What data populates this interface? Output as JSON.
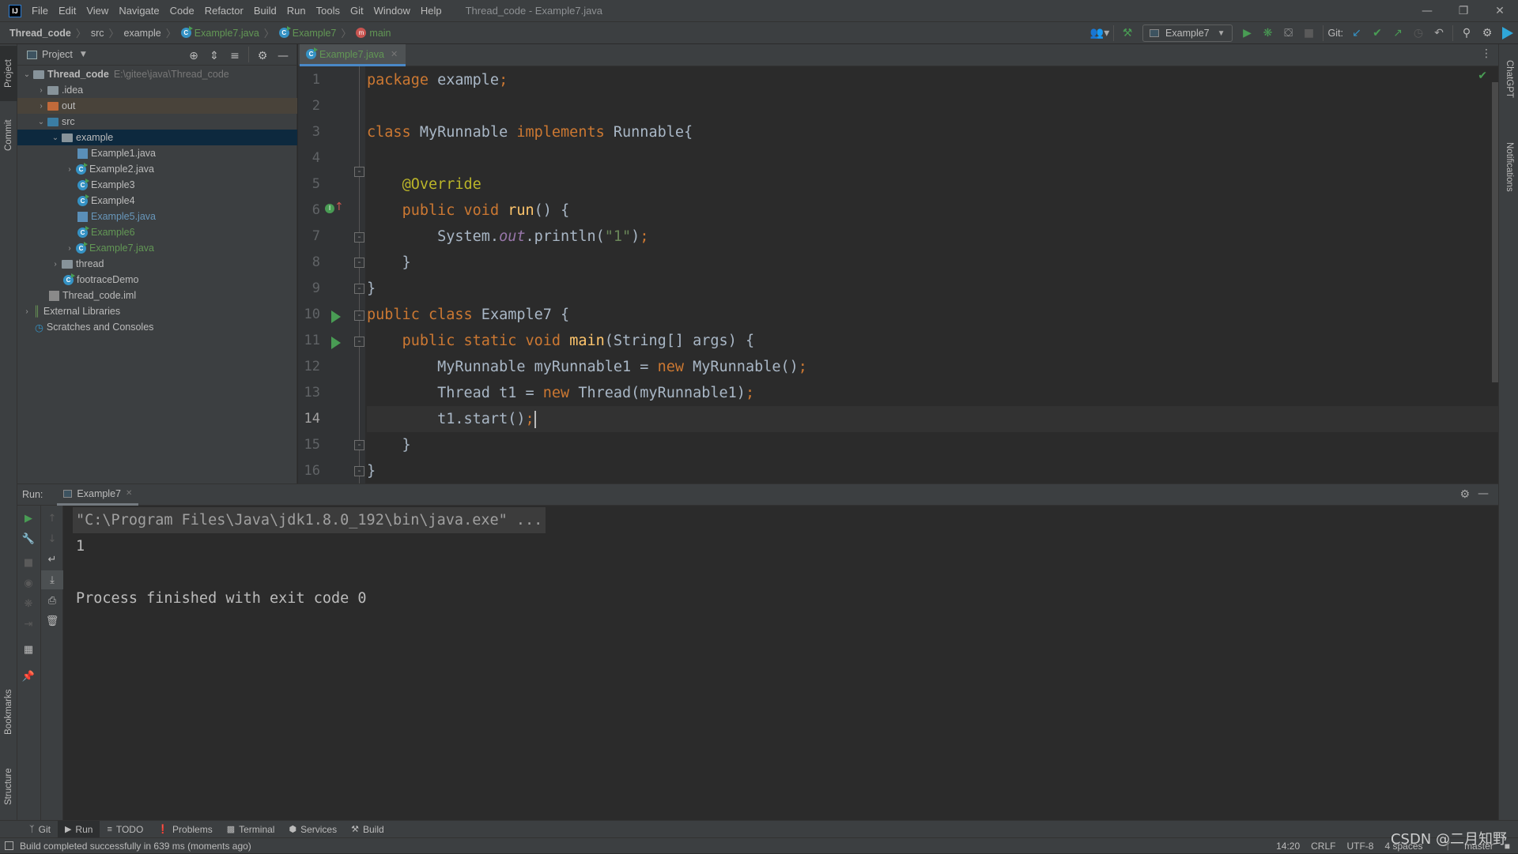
{
  "app": {
    "logo": "IJ",
    "menu": [
      "File",
      "Edit",
      "View",
      "Navigate",
      "Code",
      "Refactor",
      "Build",
      "Run",
      "Tools",
      "Git",
      "Window",
      "Help"
    ],
    "window_title": "Thread_code - Example7.java"
  },
  "breadcrumb": {
    "project": "Thread_code",
    "items": [
      "src",
      "example",
      "Example7.java",
      "Example7",
      "main"
    ]
  },
  "toolbar": {
    "run_config": "Example7",
    "git_label": "Git:"
  },
  "left_stripe": {
    "project": "Project",
    "commit": "Commit",
    "bookmarks": "Bookmarks",
    "structure": "Structure"
  },
  "right_stripe": {
    "chatgpt": "ChatGPT",
    "notifications": "Notifications"
  },
  "project_panel": {
    "title": "Project",
    "root": {
      "name": "Thread_code",
      "path": "E:\\gitee\\java\\Thread_code"
    },
    "tree": [
      {
        "name": ".idea",
        "type": "folder",
        "depth": 1,
        "expanded": false
      },
      {
        "name": "out",
        "type": "folder-excluded",
        "depth": 1,
        "expanded": false
      },
      {
        "name": "src",
        "type": "folder-source",
        "depth": 1,
        "expanded": true
      },
      {
        "name": "example",
        "type": "package",
        "depth": 2,
        "expanded": true,
        "selected": true
      },
      {
        "name": "Example1.java",
        "type": "java-file",
        "depth": 3
      },
      {
        "name": "Example2.java",
        "type": "class",
        "depth": 3,
        "expandable": true
      },
      {
        "name": "Example3",
        "type": "class",
        "depth": 3
      },
      {
        "name": "Example4",
        "type": "class",
        "depth": 3
      },
      {
        "name": "Example5.java",
        "type": "java-file",
        "depth": 3,
        "status": "modified"
      },
      {
        "name": "Example6",
        "type": "class",
        "depth": 3,
        "status": "added"
      },
      {
        "name": "Example7.java",
        "type": "class",
        "depth": 3,
        "status": "added",
        "expandable": true
      },
      {
        "name": "thread",
        "type": "package",
        "depth": 2,
        "expanded": false
      },
      {
        "name": "footraceDemo",
        "type": "class",
        "depth": 2
      },
      {
        "name": "Thread_code.iml",
        "type": "iml",
        "depth": 1
      }
    ],
    "external_libraries": "External Libraries",
    "scratches": "Scratches and Consoles"
  },
  "editor": {
    "tab": "Example7.java",
    "current_line": 14,
    "lines": [
      "package example;",
      "",
      "class MyRunnable implements Runnable{",
      "",
      "    @Override",
      "    public void run() {",
      "        System.out.println(\"1\");",
      "    }",
      "}",
      "public class Example7 {",
      "    public static void main(String[] args) {",
      "        MyRunnable myRunnable1 = new MyRunnable();",
      "        Thread t1 = new Thread(myRunnable1);",
      "        t1.start();",
      "    }",
      "}"
    ]
  },
  "run_panel": {
    "label": "Run:",
    "tab": "Example7",
    "output": [
      "\"C:\\Program Files\\Java\\jdk1.8.0_192\\bin\\java.exe\" ...",
      "1",
      "",
      "Process finished with exit code 0"
    ]
  },
  "bottom_tools": [
    "Git",
    "Run",
    "TODO",
    "Problems",
    "Terminal",
    "Services",
    "Build"
  ],
  "status": {
    "message": "Build completed successfully in 639 ms (moments ago)",
    "position": "14:20",
    "line_sep": "CRLF",
    "encoding": "UTF-8",
    "indent": "4 spaces",
    "branch": "master"
  },
  "watermark": "CSDN @二月知野"
}
